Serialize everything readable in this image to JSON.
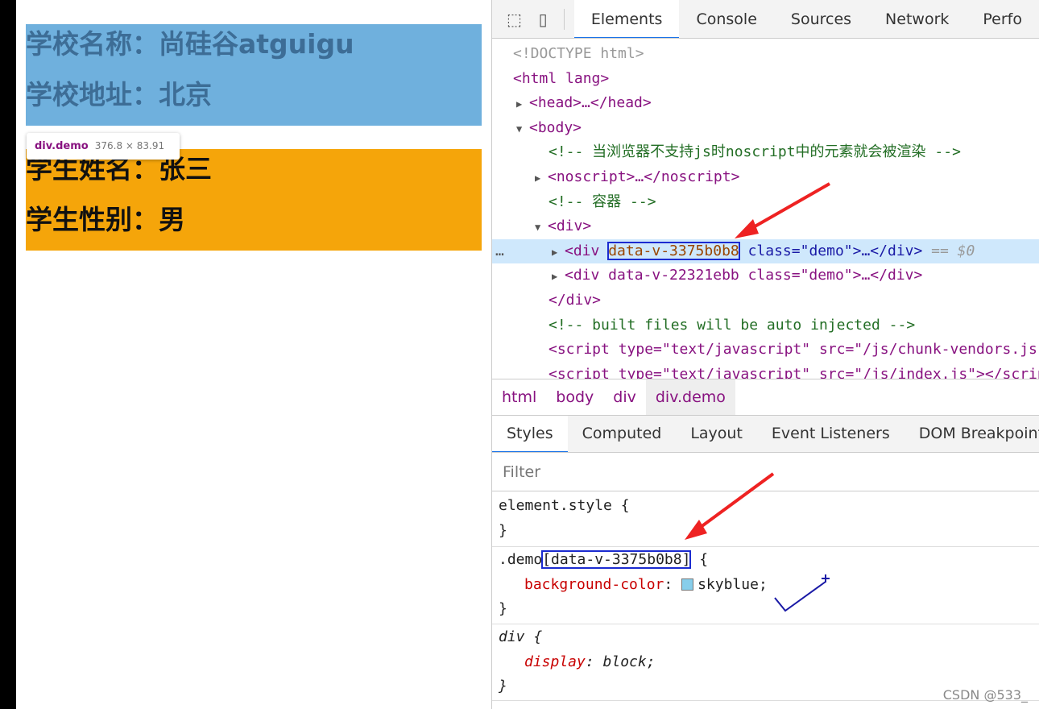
{
  "page": {
    "school": {
      "name": "学校名称：尚硅谷atguigu",
      "address": "学校地址：北京",
      "bg": "#6fb0dd"
    },
    "student": {
      "name": "学生姓名：张三",
      "gender": "学生性别：男",
      "bg": "#f5a50a"
    },
    "tooltip": {
      "selector": "div.demo",
      "size": "376.8 × 83.91"
    }
  },
  "devtools": {
    "tabs": [
      "Elements",
      "Console",
      "Sources",
      "Network",
      "Perfo"
    ],
    "active_tab": "Elements",
    "icons": [
      "inspect-cursor-icon",
      "device-toggle-icon"
    ],
    "tree": {
      "doctype": "<!DOCTYPE html>",
      "html_open": "<html lang>",
      "head": "<head>…</head>",
      "body_open": "<body>",
      "comment1": "<!-- 当浏览器不支持js时noscript中的元素就会被渲染 -->",
      "noscript": "<noscript>…</noscript>",
      "comment2": "<!-- 容器 -->",
      "div_open": "<div>",
      "sel_pre": "<div ",
      "sel_attr": "data-v-3375b0b8",
      "sel_post": " class=\"demo\">…</div>",
      "sel_marker": "== $0",
      "dots": "…",
      "div2": "<div data-v-22321ebb class=\"demo\">…</div>",
      "div_close": "</div>",
      "comment3": "<!-- built files will be auto injected -->",
      "script1": "<script type=\"text/javascript\" src=\"/js/chunk-vendors.js\">",
      "script2": "<script type=\"text/javascript\" src=\"/js/index.js\"></script>"
    },
    "breadcrumbs": [
      "html",
      "body",
      "div",
      "div.demo"
    ],
    "style_tabs": [
      "Styles",
      "Computed",
      "Layout",
      "Event Listeners",
      "DOM Breakpoints"
    ],
    "active_style_tab": "Styles",
    "filter_placeholder": "Filter",
    "rules": {
      "element_style": "element.style {",
      "close": "}",
      "demo_selector_pre": ".demo",
      "demo_selector_attr": "[data-v-3375b0b8]",
      "demo_open": " {",
      "demo_prop": "background-color",
      "demo_value": "skyblue",
      "swatch_color": "#87ceeb",
      "div_selector": "div {",
      "div_prop": "display",
      "div_value": "block"
    }
  },
  "watermark": "CSDN @533_"
}
